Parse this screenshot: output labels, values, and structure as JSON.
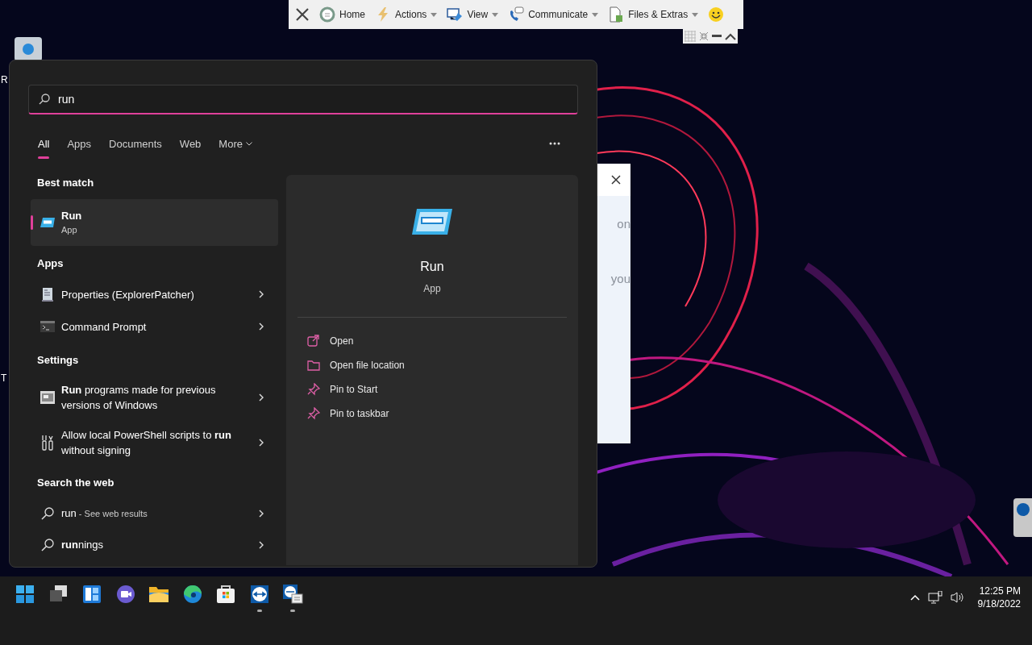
{
  "remote_toolbar": {
    "items": [
      {
        "kind": "home",
        "label": "Home",
        "dropdown": false
      },
      {
        "kind": "actions",
        "label": "Actions",
        "dropdown": true
      },
      {
        "kind": "view",
        "label": "View",
        "dropdown": true
      },
      {
        "kind": "communicate",
        "label": "Communicate",
        "dropdown": true
      },
      {
        "kind": "files",
        "label": "Files & Extras",
        "dropdown": true
      }
    ]
  },
  "desktop_icons": [
    {
      "label": "R"
    },
    {
      "label": "T"
    }
  ],
  "background_dialog": {
    "texts": [
      "on",
      "you"
    ]
  },
  "search": {
    "value": "run"
  },
  "filter_tabs": [
    {
      "label": "All",
      "selected": true,
      "dropdown": false
    },
    {
      "label": "Apps",
      "selected": false,
      "dropdown": false
    },
    {
      "label": "Documents",
      "selected": false,
      "dropdown": false
    },
    {
      "label": "Web",
      "selected": false,
      "dropdown": false
    },
    {
      "label": "More",
      "selected": false,
      "dropdown": true
    }
  ],
  "sections": [
    {
      "title": "Best match",
      "items": [
        {
          "kind": "run",
          "title": "Run",
          "subtitle": "App",
          "selected": true
        }
      ]
    },
    {
      "title": "Apps",
      "items": [
        {
          "kind": "properties",
          "title": "Properties (ExplorerPatcher)",
          "selected": false
        },
        {
          "kind": "cmd",
          "title": "Command Prompt",
          "selected": false
        }
      ]
    },
    {
      "title": "Settings",
      "items": [
        {
          "kind": "compat",
          "title": "**Run** programs made for previous versions of Windows",
          "selected": false
        },
        {
          "kind": "powershell",
          "title": "Allow local PowerShell scripts to **run** without signing",
          "selected": false
        }
      ]
    },
    {
      "title": "Search the web",
      "items": [
        {
          "kind": "web",
          "title": "run",
          "suffix": "- See web results",
          "selected": false
        },
        {
          "kind": "web",
          "title": "**run**nings",
          "selected": false
        }
      ]
    }
  ],
  "detail": {
    "title": "Run",
    "subtitle": "App",
    "actions": [
      {
        "kind": "open",
        "label": "Open"
      },
      {
        "kind": "folder",
        "label": "Open file location"
      },
      {
        "kind": "pin",
        "label": "Pin to Start"
      },
      {
        "kind": "pin",
        "label": "Pin to taskbar"
      }
    ]
  },
  "taskbar": {
    "apps": [
      {
        "kind": "start",
        "running": false
      },
      {
        "kind": "taskview",
        "running": false
      },
      {
        "kind": "widgets",
        "running": false
      },
      {
        "kind": "chat",
        "running": false
      },
      {
        "kind": "explorer",
        "running": false
      },
      {
        "kind": "edge",
        "running": false
      },
      {
        "kind": "store",
        "running": false
      },
      {
        "kind": "teamviewer",
        "running": true
      },
      {
        "kind": "meeting",
        "running": true
      }
    ]
  },
  "clock": {
    "time": "12:25 PM",
    "date": "9/18/2022"
  }
}
